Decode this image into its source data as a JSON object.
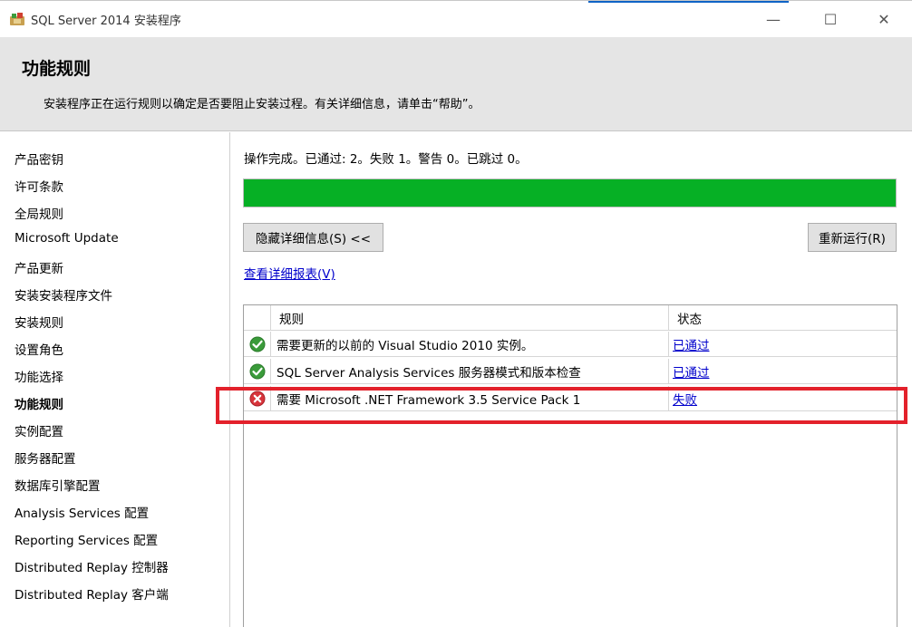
{
  "window": {
    "title": "SQL Server 2014 安装程序",
    "controls": {
      "minimize": "—",
      "maximize": "☐",
      "close": "✕"
    }
  },
  "header": {
    "title": "功能规则",
    "subtitle": "安装程序正在运行规则以确定是否要阻止安装过程。有关详细信息，请单击“帮助”。"
  },
  "nav": {
    "items": [
      {
        "label": "产品密钥",
        "active": false
      },
      {
        "label": "许可条款",
        "active": false
      },
      {
        "label": "全局规则",
        "active": false
      },
      {
        "label": "Microsoft Update",
        "active": false
      },
      {
        "label": "产品更新",
        "active": false
      },
      {
        "label": "安装安装程序文件",
        "active": false
      },
      {
        "label": "安装规则",
        "active": false
      },
      {
        "label": "设置角色",
        "active": false
      },
      {
        "label": "功能选择",
        "active": false
      },
      {
        "label": "功能规则",
        "active": true
      },
      {
        "label": "实例配置",
        "active": false
      },
      {
        "label": "服务器配置",
        "active": false
      },
      {
        "label": "数据库引擎配置",
        "active": false
      },
      {
        "label": "Analysis Services 配置",
        "active": false
      },
      {
        "label": "Reporting Services 配置",
        "active": false
      },
      {
        "label": "Distributed Replay 控制器",
        "active": false
      },
      {
        "label": "Distributed Replay 客户端",
        "active": false
      }
    ]
  },
  "main": {
    "status_text": "操作完成。已通过: 2。失败 1。警告 0。已跳过 0。",
    "progress_percent": 100,
    "progress_color": "#06b025",
    "hide_details_button": "隐藏详细信息(S) <<",
    "rerun_button": "重新运行(R)",
    "view_report_link": "查看详细报表(V)",
    "table": {
      "columns": {
        "rule": "规则",
        "status": "状态"
      },
      "rows": [
        {
          "icon": "pass-check-icon",
          "rule": "需要更新的以前的 Visual Studio 2010 实例。",
          "status": "已通过"
        },
        {
          "icon": "pass-check-icon",
          "rule": "SQL Server Analysis Services 服务器模式和版本检查",
          "status": "已通过"
        },
        {
          "icon": "fail-x-icon",
          "rule": "需要 Microsoft .NET Framework 3.5 Service Pack 1",
          "status": "失败"
        }
      ]
    }
  },
  "colors": {
    "header_bg": "#e5e5e5",
    "link": "#0000cc",
    "highlight_border": "#e3212b",
    "pass_green": "#3a9b3a",
    "fail_red": "#d8343b"
  }
}
